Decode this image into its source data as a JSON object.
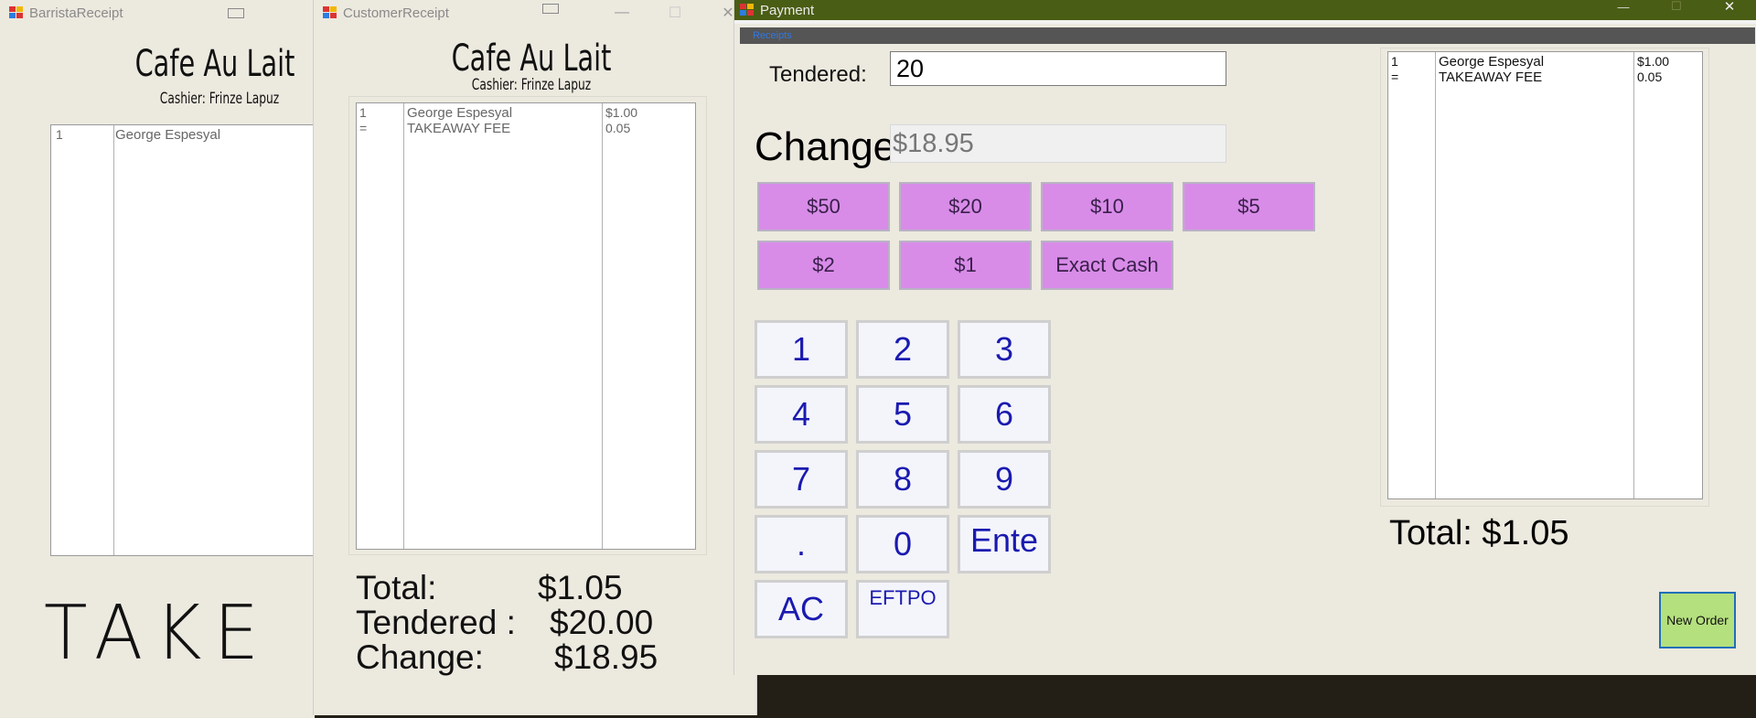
{
  "barista": {
    "title": "BarristaReceipt",
    "store_name": "Cafe Au Lait",
    "cashier": "Cashier: Frinze Lapuz",
    "rows": [
      {
        "qty": "1",
        "item": "George Espesyal"
      }
    ],
    "big_text": "TAKE"
  },
  "customer": {
    "title": "CustomerReceipt",
    "store_name": "Cafe Au Lait",
    "cashier": "Cashier: Frinze Lapuz",
    "rows": [
      {
        "qty": "1",
        "item": "George Espesyal",
        "price": "$1.00"
      },
      {
        "qty": "=",
        "item": "TAKEAWAY FEE",
        "price": "0.05"
      }
    ],
    "total_label": "Total:",
    "total_value": "$1.05",
    "tendered_label": "Tendered :",
    "tendered_value": "$20.00",
    "change_label": "Change:",
    "change_value": "$18.95"
  },
  "payment": {
    "title": "Payment",
    "menu_label": "Receipts",
    "tendered_label": "Tendered:",
    "tendered_value": "20",
    "change_label": "Change",
    "change_value": "$18.95",
    "cash_buttons": [
      "$50",
      "$20",
      "$10",
      "$5",
      "$2",
      "$1",
      "Exact Cash"
    ],
    "keys": [
      "1",
      "2",
      "3",
      "4",
      "5",
      "6",
      "7",
      "8",
      "9",
      ".",
      "0",
      "Ente",
      "AC",
      "EFTPO"
    ],
    "rows": [
      {
        "qty": "1",
        "item": "George Espesyal",
        "price": "$1.00"
      },
      {
        "qty": "=",
        "item": "TAKEAWAY FEE",
        "price": "0.05"
      }
    ],
    "total": "Total: $1.05",
    "new_order_label": "New Order"
  },
  "window_controls": {
    "minimize": "—",
    "maximize": "☐",
    "close": "✕"
  },
  "colors": {
    "payment_titlebar": "#4a5d14",
    "menu_bar": "#555555",
    "cash_button": "#d88ce8",
    "keypad_text": "#1a1ab0",
    "new_order_button": "#b5e07e",
    "window_bg": "#ece9df"
  }
}
